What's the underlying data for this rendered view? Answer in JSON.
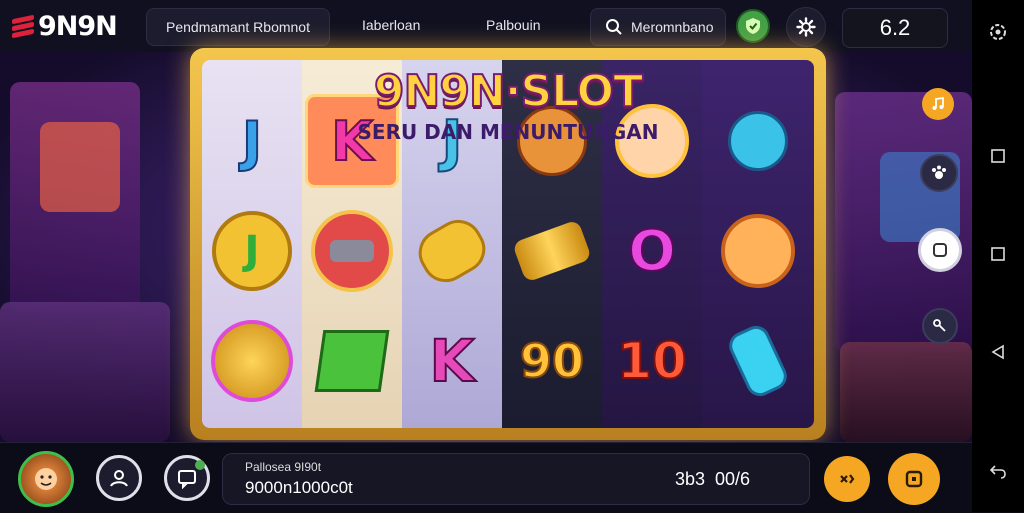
{
  "header": {
    "logo_text": "9N9N",
    "search_pill_label": "Pendmamant Rbomnot",
    "nav1": "Iaberloan",
    "nav2": "Palbouin",
    "search_label": "Meromnbano",
    "score": "6.2"
  },
  "game": {
    "title": "9N9N·SLOT",
    "subtitle": "SERU DAN MENUNTUNGAN",
    "reels": [
      [
        "J",
        "J",
        "coin"
      ],
      [
        "K",
        "horn",
        "gem"
      ],
      [
        "J",
        "phone",
        "K"
      ],
      [
        "cat",
        "scroll",
        "90"
      ],
      [
        "face",
        "O",
        "10"
      ],
      [
        "robot",
        "cat-face",
        "phone"
      ]
    ]
  },
  "footer": {
    "balance_label": "Pallosea 9I90t",
    "balance_value": "9000n1000c0t",
    "rate_label": "3b3",
    "rate_value": "00/6"
  },
  "colors": {
    "accent": "#f5a623",
    "panel": "#f4c64d",
    "green": "#4caf50"
  },
  "icons": {
    "sys_top": "settings-gear",
    "sys1": "square",
    "sys2": "square",
    "sys3": "back-triangle",
    "sys4": "return-arrow"
  }
}
